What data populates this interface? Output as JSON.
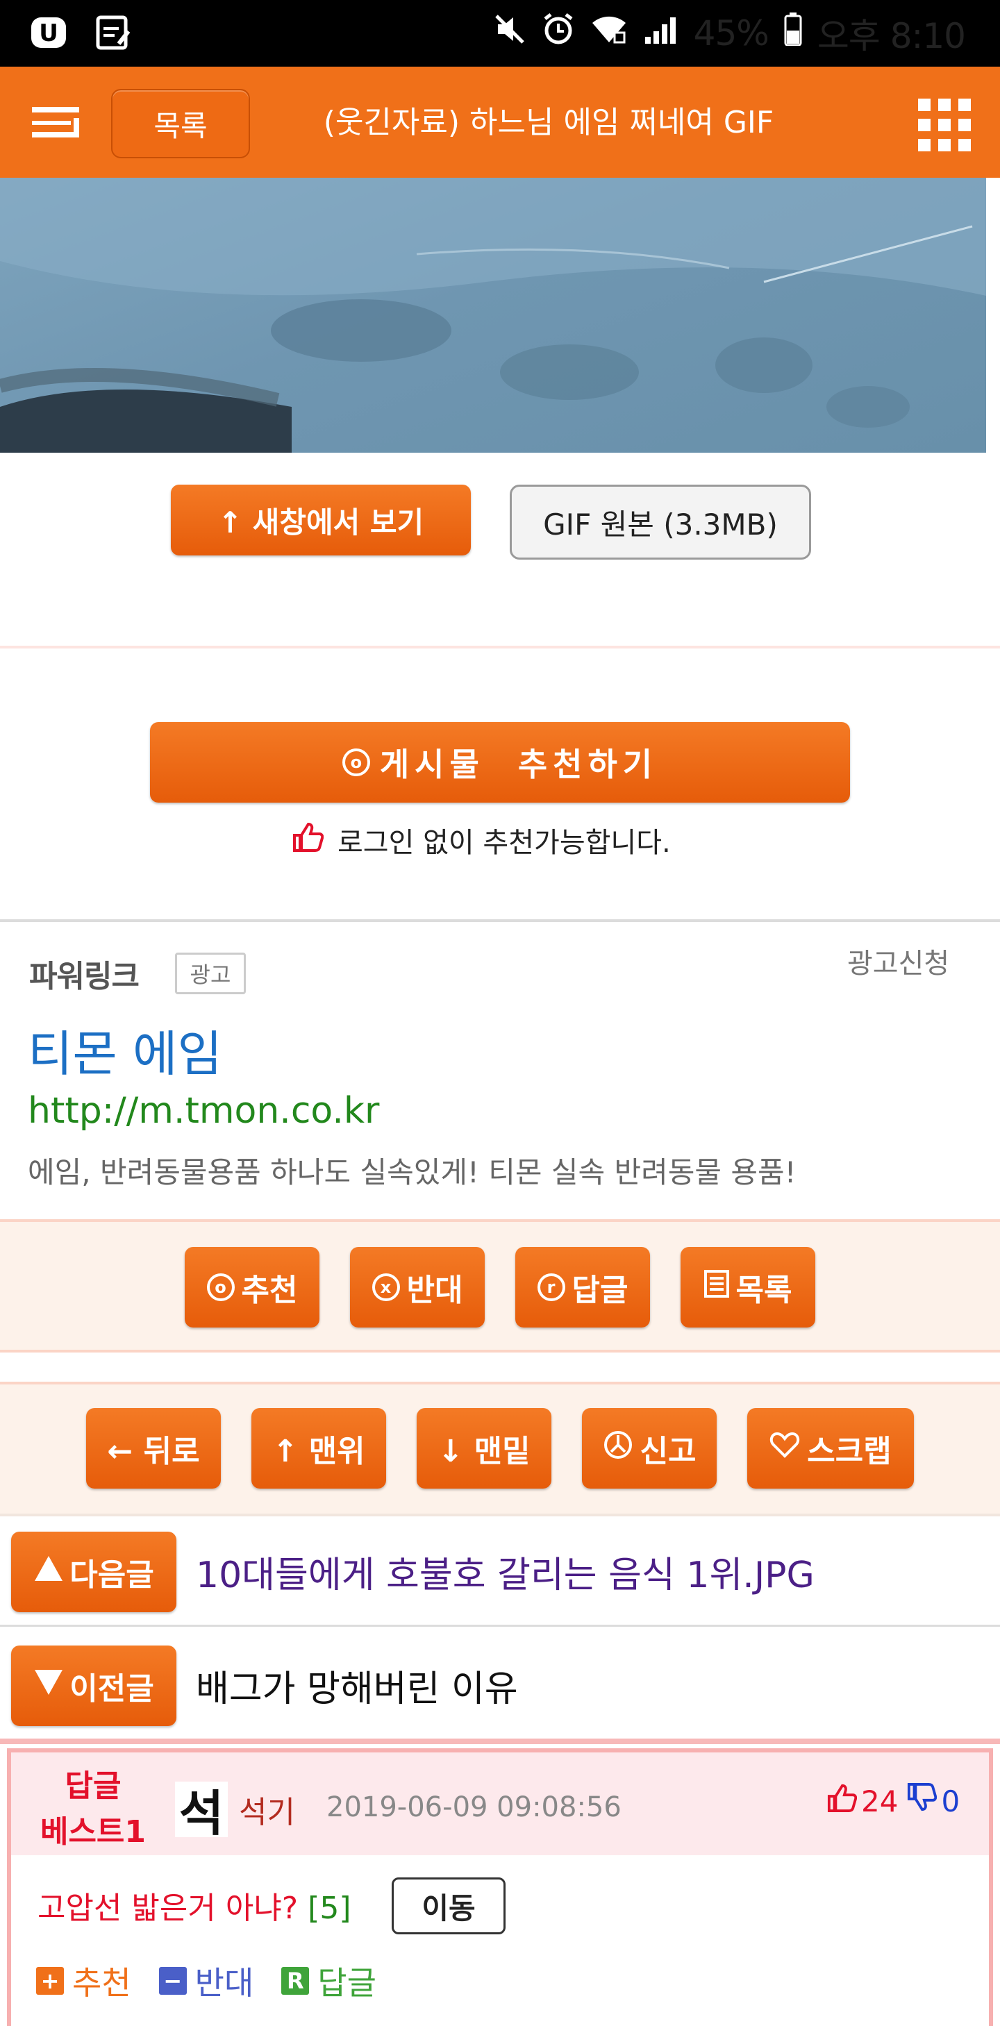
{
  "status_bar": {
    "battery": "45%",
    "time": "오후 8:10"
  },
  "header": {
    "list_label": "목록",
    "title": "(웃긴자료) 하느님 에임 쩌네여 GIF"
  },
  "media": {
    "open_new_label": "↑ 새창에서 보기",
    "gif_original_label": "GIF 원본 (3.3MB)"
  },
  "recommend": {
    "button_label": "게시물  추천하기",
    "note": "로그인 없이 추천가능합니다."
  },
  "powerlink": {
    "title": "파워링크",
    "badge": "광고",
    "request": "광고신청",
    "ad_title": "티몬 에임",
    "ad_url": "http://m.tmon.co.kr",
    "ad_desc": "에임, 반려동물용품 하나도 실속있게! 티몬 실속 반려동물 용품!"
  },
  "actions": [
    {
      "icon": "o",
      "label": "추천"
    },
    {
      "icon": "x",
      "label": "반대"
    },
    {
      "icon": "r",
      "label": "답글"
    },
    {
      "icon": "list",
      "label": "목록"
    }
  ],
  "nav_actions": [
    {
      "label": "← 뒤로"
    },
    {
      "label": "↑ 맨위"
    },
    {
      "label": "↓ 맨밑"
    },
    {
      "label": "신고"
    },
    {
      "label": "스크랩"
    }
  ],
  "posts": {
    "next_label": "다음글",
    "next_title": "10대들에게 호불호 갈리는 음식 1위.JPG",
    "prev_label": "이전글",
    "prev_title": "배그가 망해버린 이유"
  },
  "best_reply": {
    "label_line1": "답글",
    "label_line2": "베스트1",
    "avatar_char": "석",
    "author": "석기",
    "date": "2019-06-09 09:08:56",
    "up_votes": "24",
    "down_votes": "0",
    "text": "고압선 밟은거 아냐?",
    "reply_count": "[5]",
    "move_label": "이동",
    "recommend": "추천",
    "oppose": "반대",
    "reply": "답글"
  },
  "colors": {
    "brand_orange": "#f07019",
    "link_blue": "#1c6fc4",
    "url_green": "#22881c",
    "best_red": "#e3112b"
  }
}
